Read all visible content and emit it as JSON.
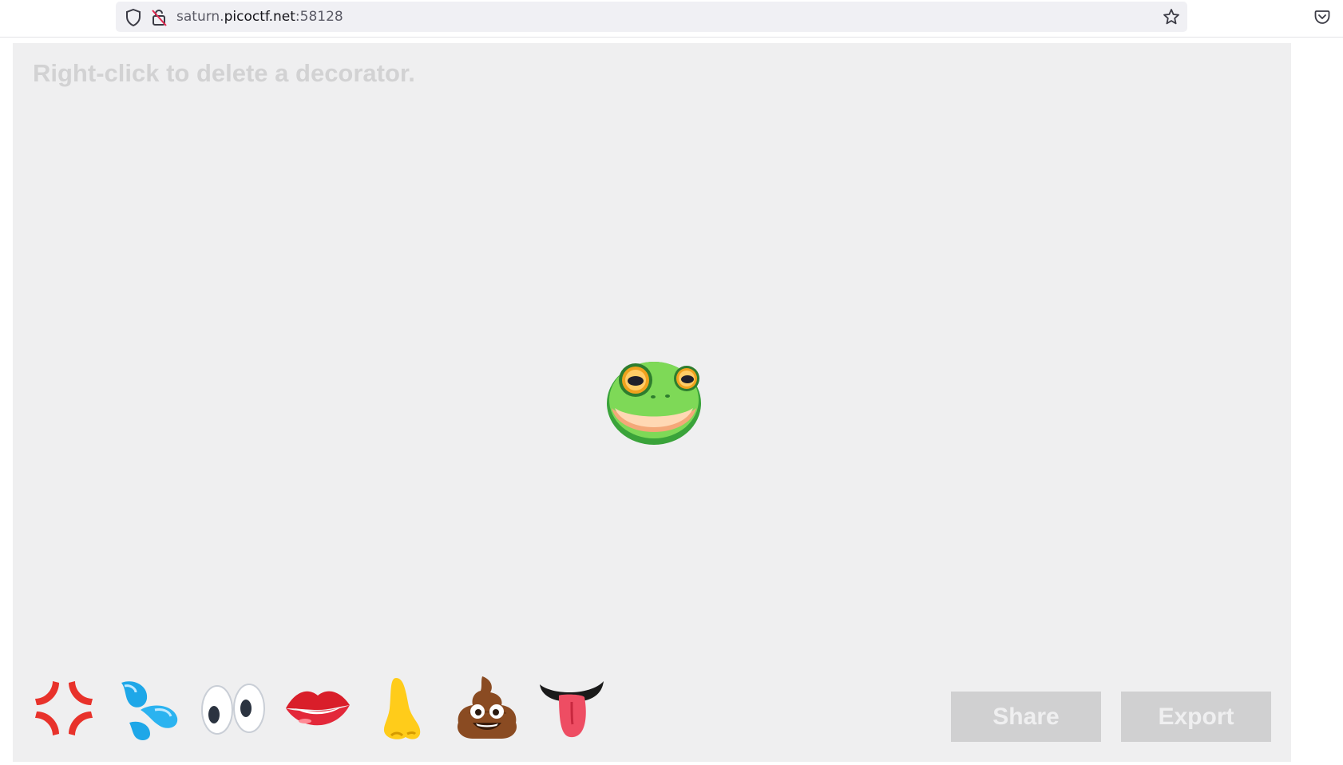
{
  "browser": {
    "url_prefix": "saturn.",
    "url_host": "picoctf.net",
    "url_port": ":58128",
    "icons": [
      "shield-icon",
      "insecure-lock-icon",
      "bookmark-star-icon",
      "pocket-icon"
    ]
  },
  "app": {
    "hint": "Right-click to delete a decorator.",
    "face": "frog-face",
    "decorators": [
      {
        "name": "anger-symbol"
      },
      {
        "name": "sweat-droplets"
      },
      {
        "name": "eyes"
      },
      {
        "name": "lips"
      },
      {
        "name": "nose"
      },
      {
        "name": "pile-of-poo"
      },
      {
        "name": "tongue-mouth"
      }
    ],
    "share_label": "Share",
    "export_label": "Export"
  },
  "colors": {
    "canvas_bg": "#efeff0",
    "hint_text": "#d2d2d3",
    "button_bg": "#d0d0d1",
    "button_text": "#efeff0"
  }
}
